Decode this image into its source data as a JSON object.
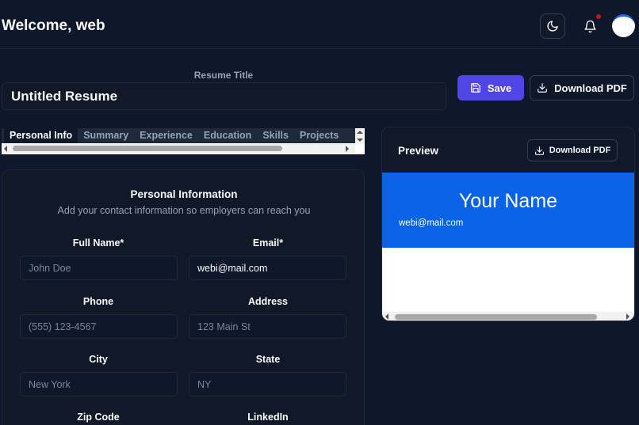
{
  "header": {
    "welcome": "Welcome, web",
    "theme_icon": "moon-icon",
    "bell_icon": "bell-icon"
  },
  "resume_title": {
    "label": "Resume Title",
    "value": "Untitled Resume"
  },
  "actions": {
    "save_label": "Save",
    "download_label": "Download PDF"
  },
  "tabs": [
    {
      "label": "Personal Info",
      "active": true
    },
    {
      "label": "Summary"
    },
    {
      "label": "Experience"
    },
    {
      "label": "Education"
    },
    {
      "label": "Skills"
    },
    {
      "label": "Projects"
    }
  ],
  "form": {
    "title": "Personal Information",
    "subtitle": "Add your contact information so employers can reach you",
    "fields": {
      "full_name": {
        "label": "Full Name*",
        "value": "",
        "placeholder": "John Doe"
      },
      "email": {
        "label": "Email*",
        "value": "webi@mail.com",
        "placeholder": ""
      },
      "phone": {
        "label": "Phone",
        "value": "",
        "placeholder": "(555) 123-4567"
      },
      "address": {
        "label": "Address",
        "value": "",
        "placeholder": "123 Main St"
      },
      "city": {
        "label": "City",
        "value": "",
        "placeholder": "New York"
      },
      "state": {
        "label": "State",
        "value": "",
        "placeholder": "NY"
      },
      "zip": {
        "label": "Zip Code"
      },
      "linkedin": {
        "label": "LinkedIn"
      }
    }
  },
  "preview": {
    "title": "Preview",
    "download_label": "Download PDF",
    "name": "Your Name",
    "email": "webi@mail.com"
  },
  "colors": {
    "background": "#0f172a",
    "card": "#111827",
    "accent": "#4f46e5",
    "resume_header": "#0863e6",
    "notification_dot": "#b91c1c"
  }
}
